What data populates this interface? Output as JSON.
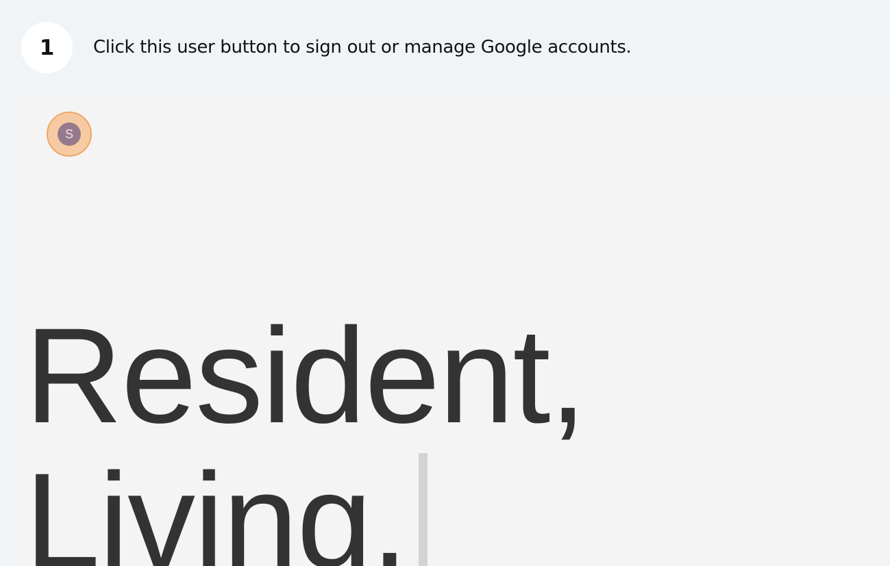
{
  "step": {
    "number": "1",
    "instruction": "Click this user button to sign out or manage Google accounts."
  },
  "screenshot": {
    "avatar": {
      "initial": "S",
      "icon": "user-avatar-icon",
      "color": "#96798a",
      "highlight_color": "#f6cba4"
    },
    "heading": {
      "line1": "Resident,",
      "line2": "Living."
    }
  }
}
